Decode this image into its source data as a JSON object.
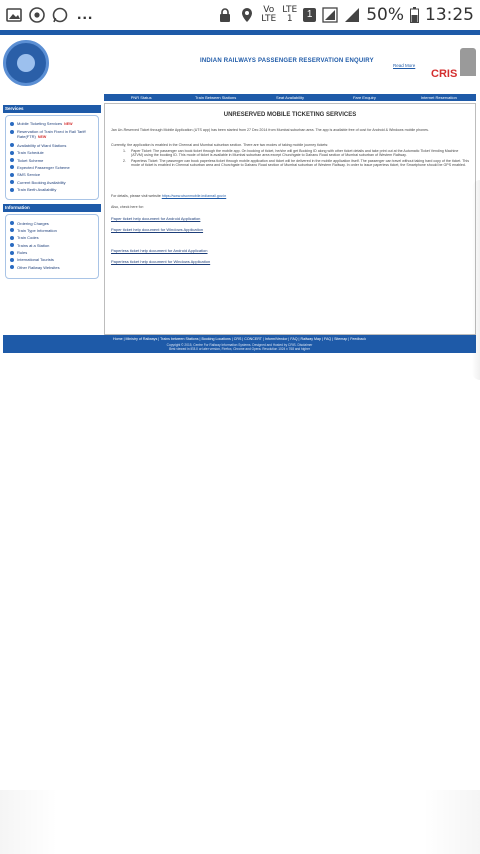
{
  "status_bar": {
    "icons_left": [
      "gallery-icon",
      "chrome-icon",
      "whatsapp-icon"
    ],
    "more": "...",
    "volte": "Vo",
    "lte_label": "LTE",
    "lte_label2": "LTE",
    "lte_sub": "1",
    "sim_badge": "1",
    "battery": "50%",
    "time": "13:25"
  },
  "header": {
    "portal_title": "INDIAN RAILWAYS PASSENGER RESERVATION ENQUIRY",
    "read_more": "Read More",
    "cris_text": "CRIS"
  },
  "nav": {
    "items": [
      "PNR Status",
      "Train Between Stations",
      "Seat Availability",
      "Fare Enquiry",
      "Internet Reservation"
    ]
  },
  "sidebar": {
    "services_title": "Services",
    "services": [
      {
        "label": "Mobile Ticketing Services",
        "badge": "NEW"
      },
      {
        "label": "Reservation of Train Fixed in Rail Tariff Rate(FTR)",
        "badge": "NEW"
      },
      {
        "label": "Availability of Ward Stations",
        "badge": ""
      },
      {
        "label": "Train Schedule",
        "badge": ""
      },
      {
        "label": "Ticket Scheme",
        "badge": ""
      },
      {
        "label": "Expected Passenger Scheme",
        "badge": ""
      },
      {
        "label": "SMS Service",
        "badge": ""
      },
      {
        "label": "Current Booking Availability",
        "badge": ""
      },
      {
        "label": "Train Berth Availability",
        "badge": ""
      }
    ],
    "information_title": "Information",
    "information": [
      "Ordering Charges",
      "Train Type Information",
      "Train Codes",
      "Trains at a Station",
      "Rules",
      "International Tourists",
      "Other Railway Websites"
    ]
  },
  "content": {
    "title": "UNRESERVED MOBILE TICKETING SERVICES",
    "intro": "Jan Un-Reserved Ticket through Mobile Application (UTS app) has been started from 27 Dec 2014 from Mumbai suburban area. The app is available free of cost for Android & Windows mobile phones.",
    "current": "Currently, the application is enabled in the Chennai and Mumbai suburban section. There are two modes of taking mobile journey tickets:",
    "modes": [
      {
        "num": "1.",
        "text": "Paper Ticket: The passenger can book ticket through the mobile app. On booking of ticket, he/she will get Booking ID along with other ticket details and take print out at the Automatic Ticket Vending Machine (ATVM) using the booking ID. This mode of ticket is available in Mumbai suburban area except Churchgate to Dahanu Road section of Mumbai suburban of Western Railway."
      },
      {
        "num": "2.",
        "text": "Paperless Ticket: The passenger can book paperless ticket through mobile application and ticket will be delivered in the mobile application itself. The passenger can travel without taking hard copy of the ticket. This mode of ticket is enabled in Chennai suburban area and Churchgate to Dahanu Road section of Mumbai suburban of Western Railway. In order to issue paperless ticket, the Smartphone should be GPS enabled."
      }
    ],
    "details_prefix": "For details, please visit website",
    "details_link": "https://www.utsonmobile.indianrail.gov.in",
    "also_check": "Also, check here for:",
    "docs": [
      "Paper ticket help document for Android Application",
      "Paper ticket help document for Windows Application",
      "Paperless ticket help document for Android Application",
      "Paperless ticket help document for Windows Application"
    ]
  },
  "footer": {
    "links": "Home | Ministry of Railways | Trains between Stations | Booking Locations | CRS | CONCERT | Inform/Vendor | FAQ | Railway Map | FAQ | Sitemap | Feedback",
    "copyright": "Copyright © 2015, Centre For Railway Information Systems. Designed and Hosted by CRIS. Disclaimer",
    "browser_note": "Best viewed in IE8.0 or later version, Firefox, Chrome and Opera. Resolution 1024 x 768 and higher"
  },
  "colors": {
    "primary": "#1e5aa8",
    "badge": "#d42f2f"
  }
}
